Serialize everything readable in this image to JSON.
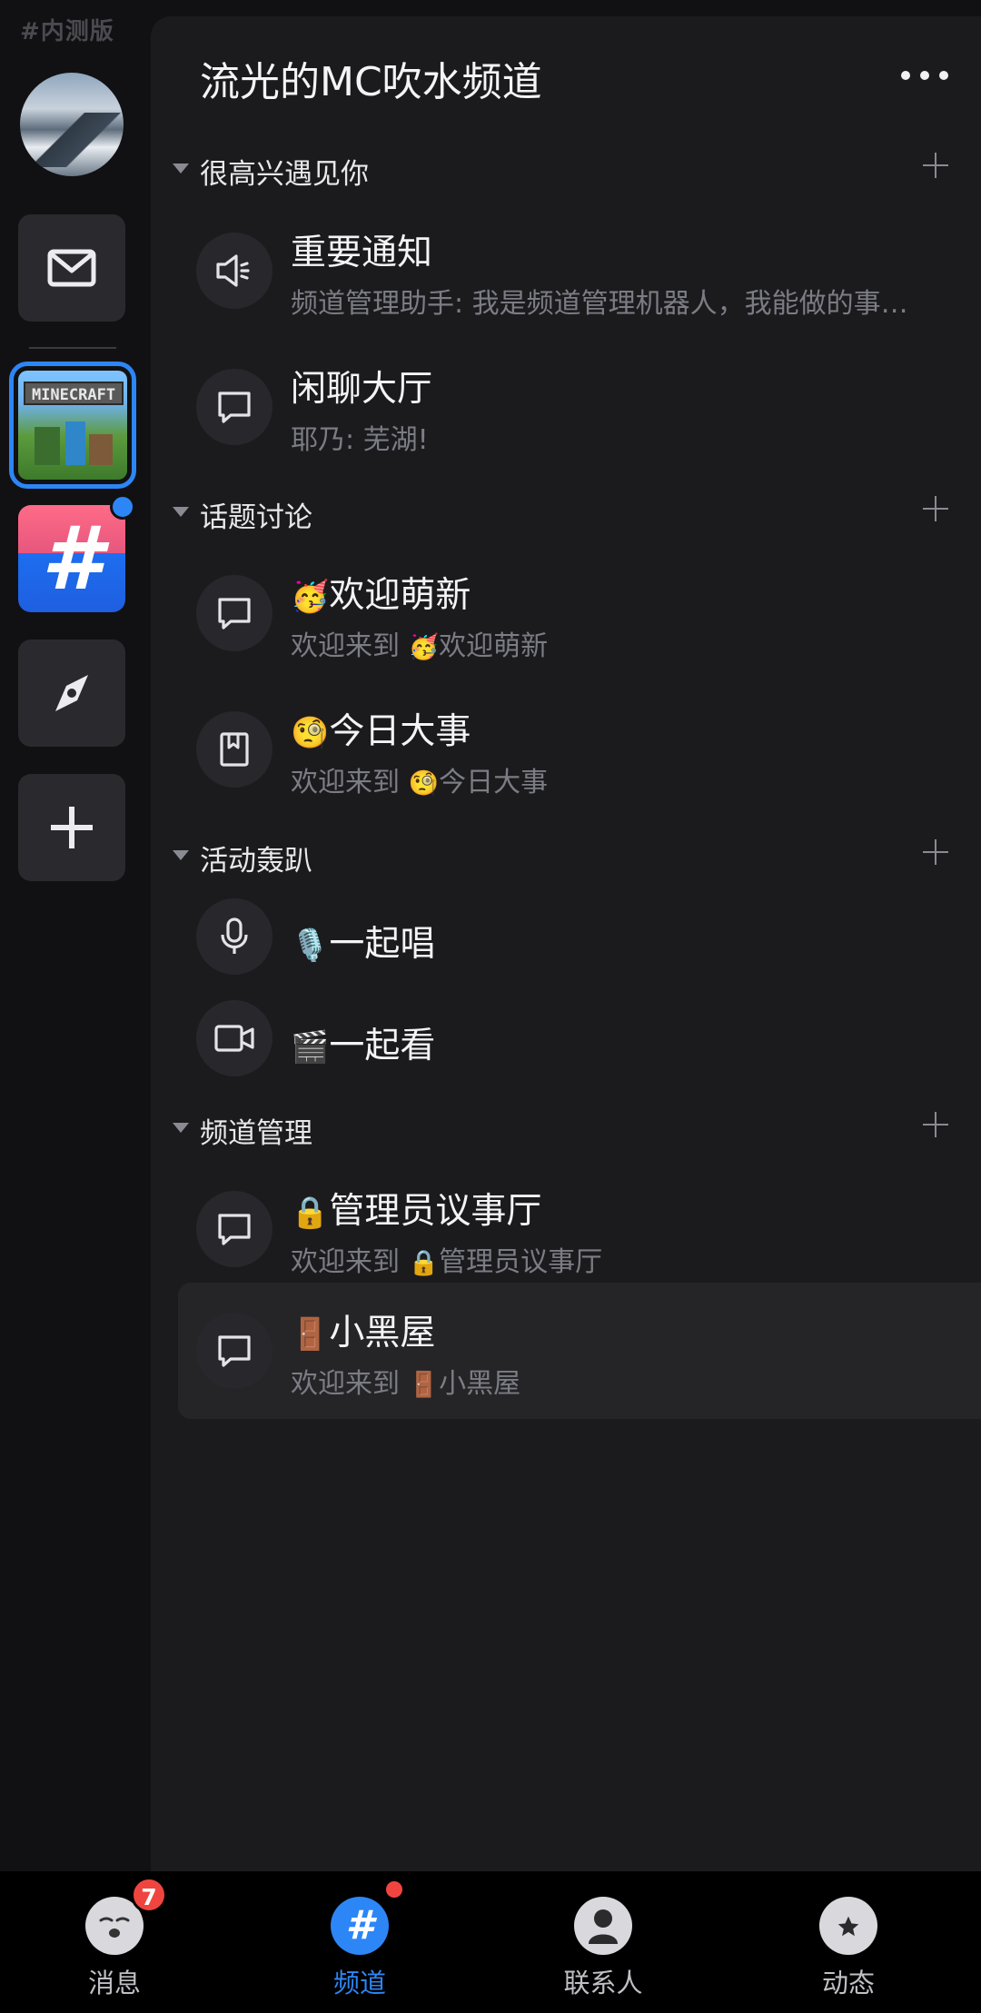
{
  "rail": {
    "beta_label": "#内测版",
    "items": [
      {
        "name": "my-avatar"
      },
      {
        "name": "mail-icon"
      },
      {
        "name": "minecraft-guild",
        "logo_text": "MINECRAFT",
        "selected": true
      },
      {
        "name": "channel-hash-guild",
        "has_dot": true
      },
      {
        "name": "compass-icon"
      },
      {
        "name": "plus-icon"
      }
    ]
  },
  "guild": {
    "title": "流光的MC吹水频道",
    "more_icon": "more-dots-icon"
  },
  "categories": [
    {
      "name": "很高兴遇见你",
      "channels": [
        {
          "icon": "speaker-icon",
          "emoji": "",
          "name": "重要通知",
          "sub": "频道管理助手: 我是频道管理机器人，我能做的事…",
          "sub_emoji": "",
          "sub_tail": ""
        },
        {
          "icon": "chat-bubble-icon",
          "emoji": "",
          "name": "闲聊大厅",
          "sub": "耶乃: 芜湖!",
          "sub_emoji": "",
          "sub_tail": ""
        }
      ]
    },
    {
      "name": "话题讨论",
      "channels": [
        {
          "icon": "chat-bubble-icon",
          "emoji": "🥳",
          "name": "欢迎萌新",
          "sub": "欢迎来到 ",
          "sub_emoji": "🥳",
          "sub_tail": "欢迎萌新"
        },
        {
          "icon": "bookmark-icon",
          "emoji": "🧐",
          "name": "今日大事",
          "sub": "欢迎来到 ",
          "sub_emoji": "🧐",
          "sub_tail": "今日大事"
        }
      ]
    },
    {
      "name": "活动轰趴",
      "channels": [
        {
          "icon": "microphone-icon",
          "emoji": "🎙️",
          "name": "一起唱"
        },
        {
          "icon": "video-camera-icon",
          "emoji": "🎬",
          "name": "一起看"
        }
      ]
    },
    {
      "name": "频道管理",
      "channels": [
        {
          "icon": "chat-bubble-icon",
          "emoji": "🔒",
          "name": "管理员议事厅",
          "sub": "欢迎来到 ",
          "sub_emoji": "🔒",
          "sub_tail": "管理员议事厅"
        },
        {
          "icon": "chat-bubble-icon",
          "emoji": "🚪",
          "name": "小黑屋",
          "sub": "欢迎来到 ",
          "sub_emoji": "🚪",
          "sub_tail": "小黑屋",
          "selected": true
        }
      ]
    }
  ],
  "tabbar": {
    "tabs": [
      {
        "label": "消息",
        "icon": "messages-avatar-icon",
        "badge": "7",
        "active": false
      },
      {
        "label": "频道",
        "icon": "channel-hash-icon",
        "dot": true,
        "active": true
      },
      {
        "label": "联系人",
        "icon": "contacts-person-icon",
        "active": false
      },
      {
        "label": "动态",
        "icon": "planet-star-icon",
        "active": false
      }
    ]
  },
  "colors": {
    "accent": "#2d86f5",
    "badge_red": "#f0453f",
    "panel_bg": "#1b1b1e",
    "rail_bg": "#111113"
  }
}
